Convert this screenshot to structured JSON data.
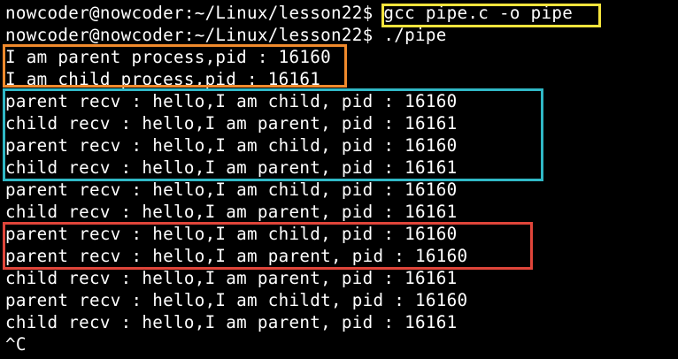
{
  "terminal": {
    "lines": [
      "nowcoder@nowcoder:~/Linux/lesson22$ gcc pipe.c -o pipe",
      "nowcoder@nowcoder:~/Linux/lesson22$ ./pipe",
      "I am parent process,pid : 16160",
      "I am child process,pid : 16161",
      "parent recv : hello,I am child, pid : 16160",
      "child recv : hello,I am parent, pid : 16161",
      "parent recv : hello,I am child, pid : 16160",
      "child recv : hello,I am parent, pid : 16161",
      "parent recv : hello,I am child, pid : 16160",
      "child recv : hello,I am parent, pid : 16161",
      "parent recv : hello,I am child, pid : 16160",
      "parent recv : hello,I am parent, pid : 16160",
      "child recv : hello,I am parent, pid : 16161",
      "parent recv : hello,I am childt, pid : 16160",
      "child recv : hello,I am parent, pid : 16161",
      "^C"
    ]
  },
  "annotations": {
    "command_highlight_color": "#f5e43c",
    "process_pid_highlight_color": "#f08a2c",
    "normal_exchange_highlight_color": "#30b8c6",
    "anomaly_highlight_color": "#e0453a"
  }
}
